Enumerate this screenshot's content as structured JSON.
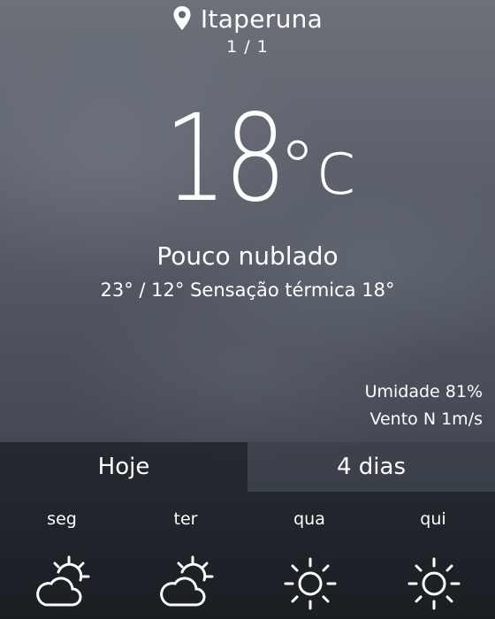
{
  "location": {
    "city": "Itaperuna",
    "page_indicator": "1 / 1",
    "icon": "location-pin-icon"
  },
  "current": {
    "temperature": "18",
    "unit": "°c",
    "condition": "Pouco nublado",
    "minmax": "23° / 12°",
    "feels_like_label": "Sensação térmica",
    "feels_like": "18°"
  },
  "details": {
    "humidity_label": "Umidade",
    "humidity_value": "81%",
    "wind_label": "Vento N",
    "wind_value": "1m/s"
  },
  "tabs": [
    {
      "label": "Hoje",
      "selected": false
    },
    {
      "label": "4 dias",
      "selected": true
    }
  ],
  "forecast": [
    {
      "day": "seg",
      "icon": "partly-cloudy-icon"
    },
    {
      "day": "ter",
      "icon": "partly-cloudy-icon"
    },
    {
      "day": "qua",
      "icon": "sunny-icon"
    },
    {
      "day": "qui",
      "icon": "sunny-icon"
    }
  ]
}
